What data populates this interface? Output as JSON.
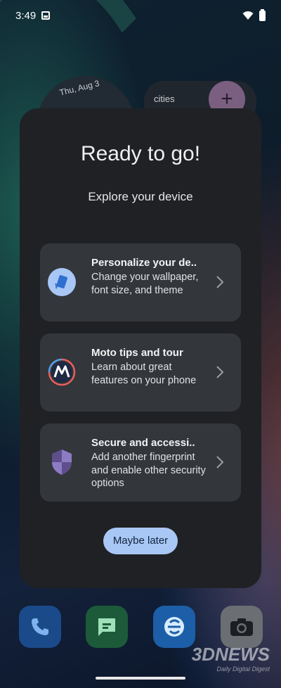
{
  "status_bar": {
    "time": "3:49"
  },
  "background": {
    "clock_date": "Thu, Aug 3",
    "cities_label": "cities",
    "add_symbol": "+"
  },
  "dialog": {
    "title": "Ready to go!",
    "subtitle": "Explore your device",
    "cards": [
      {
        "title": "Personalize your de..",
        "description": "Change your wallpaper, font size, and theme",
        "icon": "personalize-icon"
      },
      {
        "title": "Moto tips and tour",
        "description": "Learn about great features on your phone",
        "icon": "moto-logo-icon"
      },
      {
        "title": "Secure and accessi..",
        "description": "Add another fingerprint and enable other security options",
        "icon": "shield-icon"
      }
    ],
    "maybe_later_label": "Maybe later"
  },
  "dock": {
    "apps": [
      {
        "name": "phone-icon",
        "color": "#1b4a8a"
      },
      {
        "name": "messages-icon",
        "color": "#1d5a3a"
      },
      {
        "name": "browser-icon",
        "color": "#1c5fa8"
      },
      {
        "name": "camera-icon",
        "color": "#6b6e72"
      }
    ]
  },
  "watermark": {
    "main": "3DNEWS",
    "sub": "Daily Digital Digest"
  },
  "colors": {
    "accent": "#a9c7f5",
    "dialog_bg": "#1f2124",
    "card_bg": "#33363b"
  }
}
